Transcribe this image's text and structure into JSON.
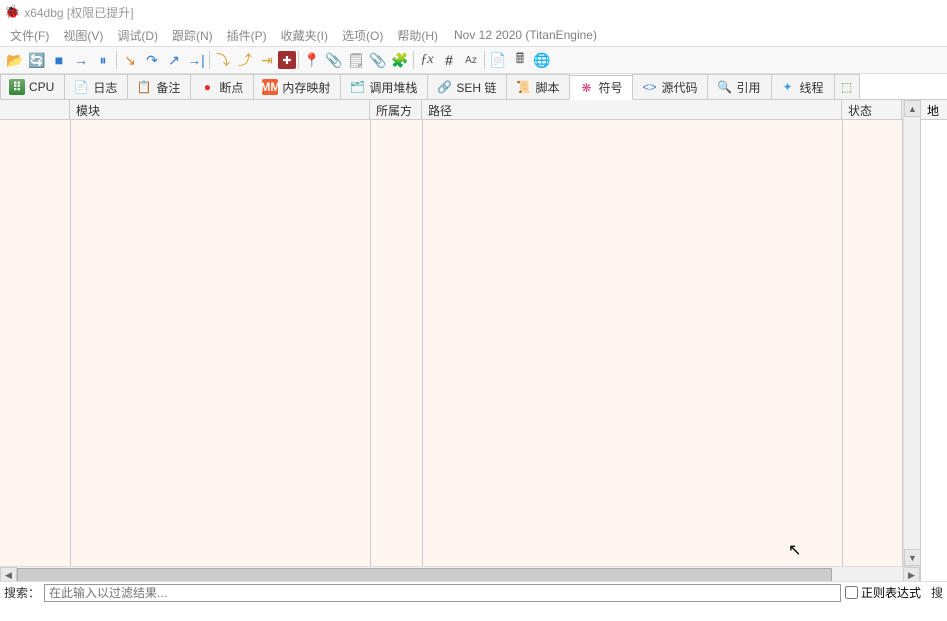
{
  "title": "x64dbg [权限已提升]",
  "menu": {
    "file": "文件(F)",
    "view": "视图(V)",
    "debug": "调试(D)",
    "trace": "跟踪(N)",
    "plugins": "插件(P)",
    "favorites": "收藏夹(I)",
    "options": "选项(O)",
    "help": "帮助(H)",
    "build": "Nov 12 2020 (TitanEngine)"
  },
  "tabs": {
    "cpu": "CPU",
    "log": "日志",
    "notes": "备注",
    "breakpoints": "断点",
    "memmap": "内存映射",
    "callstack": "调用堆栈",
    "seh": "SEH 链",
    "script": "脚本",
    "symbols": "符号",
    "source": "源代码",
    "references": "引用",
    "threads": "线程"
  },
  "columns": {
    "c0": "",
    "module": "模块",
    "party": "所属方",
    "path": "路径",
    "state": "状态",
    "addr": "地"
  },
  "search": {
    "label": "搜索：",
    "placeholder": "在此输入以过滤结果...",
    "regex": "正则表达式",
    "right": "搜"
  },
  "toolbar_icons": {
    "open": "📂",
    "restart": "🔄",
    "stop": "■",
    "run": "→",
    "pause": "⏸",
    "step_into": "↘",
    "step_over": "↷",
    "step_out": "↗",
    "run_to": "→|",
    "trace_into": "⤵",
    "trace_over": "⤴",
    "exec_till": "⇥",
    "patches": "✚",
    "a1": "📍",
    "a2": "📎",
    "a3": "🗒",
    "a4": "📎",
    "a5": "🧩",
    "fx": "ƒx",
    "hash": "#",
    "az": "Aᴢ",
    "calc": "🖩",
    "b1": "📄",
    "b2": "🖩",
    "b3": "🌐"
  }
}
